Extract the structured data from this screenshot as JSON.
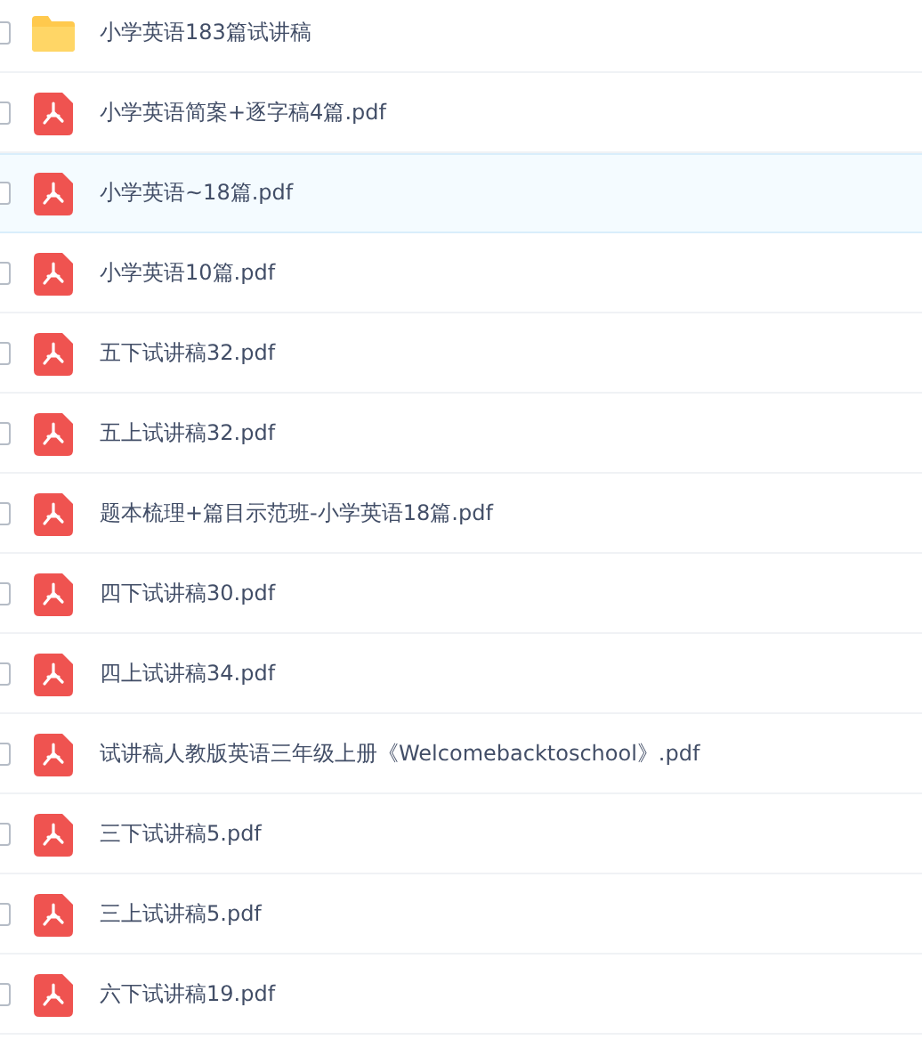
{
  "files": [
    {
      "name": "小学英语183篇试讲稿",
      "kind": "folder",
      "selected": false,
      "checked": false
    },
    {
      "name": "小学英语简案+逐字稿4篇.pdf",
      "kind": "pdf",
      "selected": false,
      "checked": false
    },
    {
      "name": "小学英语~18篇.pdf",
      "kind": "pdf",
      "selected": true,
      "checked": false
    },
    {
      "name": "小学英语10篇.pdf",
      "kind": "pdf",
      "selected": false,
      "checked": false
    },
    {
      "name": "五下试讲稿32.pdf",
      "kind": "pdf",
      "selected": false,
      "checked": false
    },
    {
      "name": "五上试讲稿32.pdf",
      "kind": "pdf",
      "selected": false,
      "checked": false
    },
    {
      "name": "题本梳理+篇目示范班-小学英语18篇.pdf",
      "kind": "pdf",
      "selected": false,
      "checked": false
    },
    {
      "name": "四下试讲稿30.pdf",
      "kind": "pdf",
      "selected": false,
      "checked": false
    },
    {
      "name": "四上试讲稿34.pdf",
      "kind": "pdf",
      "selected": false,
      "checked": false
    },
    {
      "name": "试讲稿人教版英语三年级上册《Welcomebacktoschool》.pdf",
      "kind": "pdf",
      "selected": false,
      "checked": false
    },
    {
      "name": "三下试讲稿5.pdf",
      "kind": "pdf",
      "selected": false,
      "checked": false
    },
    {
      "name": "三上试讲稿5.pdf",
      "kind": "pdf",
      "selected": false,
      "checked": false
    },
    {
      "name": "六下试讲稿19.pdf",
      "kind": "pdf",
      "selected": false,
      "checked": false
    }
  ]
}
